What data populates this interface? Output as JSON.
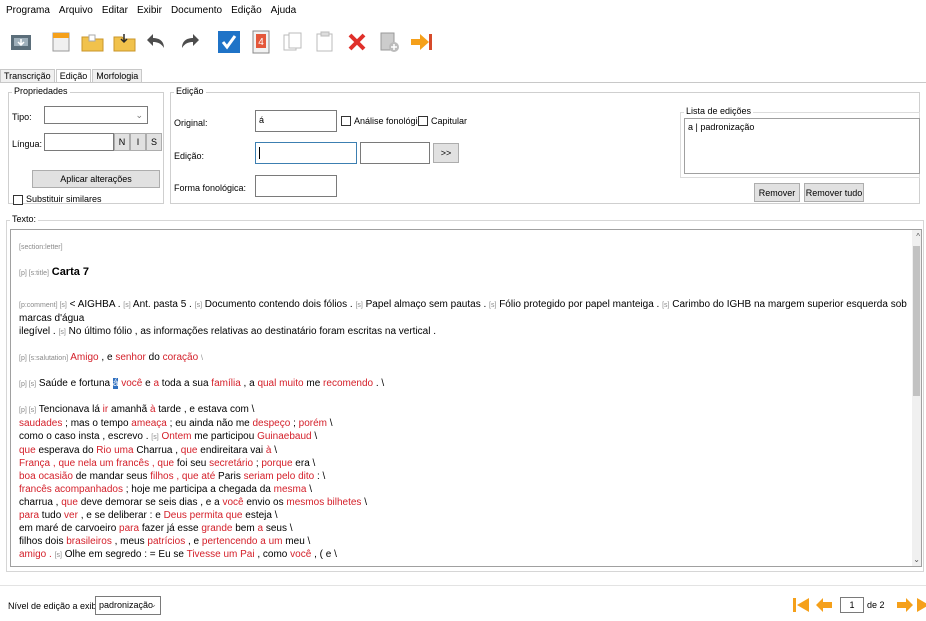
{
  "menu": [
    "Programa",
    "Arquivo",
    "Editar",
    "Exibir",
    "Documento",
    "Edição",
    "Ajuda"
  ],
  "tabs": [
    "Transcrição",
    "Edição",
    "Morfologia"
  ],
  "properties": {
    "legend": "Propriedades",
    "tipo_label": "Tipo:",
    "lingua_label": "Língua:",
    "n_label": "N",
    "i_label": "I",
    "s_label": "S",
    "apply_label": "Aplicar alterações",
    "substituir_label": "Substituir similares"
  },
  "edicao": {
    "legend": "Edição",
    "original_label": "Original:",
    "original_value": "á",
    "analise_label": "Análise fonológica",
    "capitular_label": "Capitular",
    "edicao_label": "Edição:",
    "edicao_value": "",
    "arrow_label": ">>",
    "forma_label": "Forma fonológica:"
  },
  "lista": {
    "legend": "Lista de edições",
    "item": "a | padronização",
    "remover_label": "Remover",
    "remover_tudo_label": "Remover tudo"
  },
  "texto": {
    "legend": "Texto:",
    "section_tag": "[section:letter]",
    "p_title_tag": "[p] [s:title]",
    "title": "Carta 7",
    "comment_tag": "[p:comment] [s]",
    "comment_1": "< AIGHBA .",
    "s_tag": "[s]",
    "comment_2": "Ant. pasta 5 .",
    "comment_3": "Documento contendo dois fólios .",
    "comment_4": "Papel almaço sem pautas .",
    "comment_5": "Fólio protegido por papel manteiga .",
    "comment_6": "Carimbo do IGHB na margem superior esquerda sob marcas d'água",
    "comment_7": "ilegível .",
    "comment_8": "No último fólio , as informações relativas ao destinatário foram escritas na vertical .",
    "salutation_tag": "[p] [s:salutation]",
    "sal_amigo": "Amigo",
    "sal_e": ", e",
    "sal_senhor": "senhor",
    "sal_do": "do",
    "sal_coracao": "coração",
    "sal_end": "\\",
    "ps_tag": "[p] [s]",
    "l1_a": "Saúde e fortuna",
    "l1_hl": "á",
    "l1_voce": "você",
    "l1_e": "e",
    "l1_a2": "a",
    "l1_b": "toda a sua",
    "l1_familia": "família",
    "l1_c": ", a",
    "l1_qual": "qual muito",
    "l1_me": "me",
    "l1_recomendo": "recomendo",
    "l1_end": ". \\",
    "l2_a": "Tencionava lá",
    "l2_ir": "ir",
    "l2_b": "amanhã",
    "l2_a2": "à",
    "l2_c": "tarde , e estava com \\",
    "l3_saudades": "saudades",
    "l3_a": "; mas o tempo",
    "l3_ameaca": "ameaça",
    "l3_b": "; eu ainda não me",
    "l3_despeco": "despeço",
    "l3_c": ";",
    "l3_porem": "porém",
    "l3_end": "\\",
    "l4_a": "como o caso insta , escrevo .",
    "l4_ontem": "Ontem",
    "l4_b": "me participou",
    "l4_guinaebaud": "Guinaebaud",
    "l4_end": "\\",
    "l5_que": "que",
    "l5_a": "esperava do",
    "l5_rio": "Rio uma",
    "l5_b": "Charrua ,",
    "l5_que2": "que",
    "l5_c": "endireitara vai",
    "l5_a2": "à",
    "l5_end": "\\",
    "l6_franca": "França , que nela um francês , que",
    "l6_a": "foi seu",
    "l6_secretario": "secretário",
    "l6_b": ";",
    "l6_porque": "porque",
    "l6_c": "era \\",
    "l7_boa": "boa ocasião",
    "l7_a": "de mandar seus",
    "l7_filhos": "filhos , que até",
    "l7_b": "Paris",
    "l7_seriam": "seriam pelo dito",
    "l7_end": ": \\",
    "l8_frances": "francês acompanhados",
    "l8_a": "; hoje me participa a chegada da",
    "l8_mesma": "mesma",
    "l8_end": "\\",
    "l9_a": "charrua ,",
    "l9_que": "que",
    "l9_b": "deve demorar se seis dias , e a",
    "l9_voce": "você",
    "l9_c": "envio os",
    "l9_mesmos": "mesmos bilhetes",
    "l9_end": "\\",
    "l10_para": "para",
    "l10_a": "tudo",
    "l10_ver": "ver",
    "l10_b": ", e se deliberar : e",
    "l10_deus": "Deus permita que",
    "l10_c": "esteja \\",
    "l11_a": "em maré de carvoeiro",
    "l11_para": "para",
    "l11_b": "fazer já esse",
    "l11_grande": "grande",
    "l11_c": "bem",
    "l11_a2": "a",
    "l11_d": "seus \\",
    "l12_a": "filhos dois",
    "l12_brasileiros": "brasileiros",
    "l12_b": ", meus",
    "l12_patricios": "patrícios",
    "l12_c": ", e",
    "l12_pertencendo": "pertencendo a um",
    "l12_d": "meu \\",
    "l13_amigo": "amigo .",
    "l13_a": "Olhe em segredo : = Eu se",
    "l13_tivesse": "Tivesse um Pai",
    "l13_b": ", como",
    "l13_voce": "você",
    "l13_c": ", ( e \\"
  },
  "bottom": {
    "nivel_label": "Nível de edição a exibir:",
    "nivel_value": "padronização",
    "page_value": "1",
    "page_of": "de 2"
  },
  "colors": {
    "red_text": "#d4202a",
    "orange_icon": "#f5a01a",
    "highlight": "#2f6fbf"
  }
}
